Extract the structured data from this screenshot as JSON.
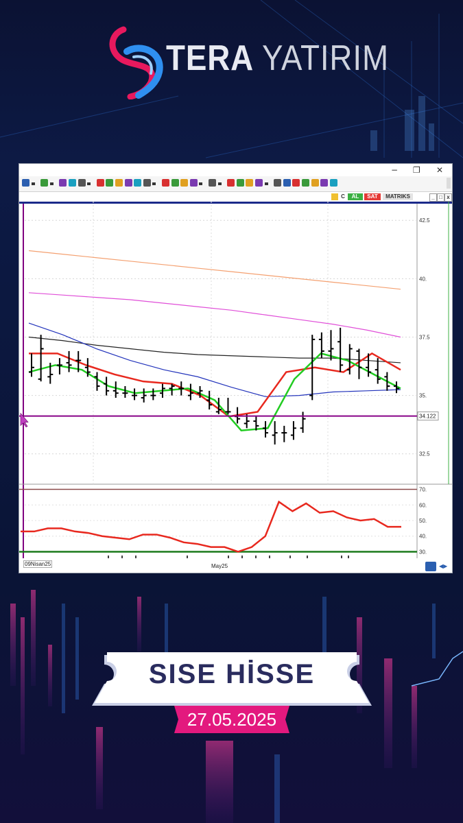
{
  "brand": {
    "name_part1": "TERA",
    "name_part2": "YATIRIM"
  },
  "window": {
    "controls": {
      "minimize": "−",
      "maximize": "❐",
      "close": "✕"
    },
    "toolbar_icons": [
      "u-icon",
      "arrow-icon",
      "globe-icon",
      "arrow-icon",
      "news-icon",
      "mail-icon",
      "m-icon",
      "arrow-icon",
      "chart-icon",
      "fx-icon",
      "user-icon",
      "chart-icon",
      "grid-icon",
      "phone-icon",
      "arrow-icon",
      "table-icon",
      "share-icon",
      "chart-icon",
      "search-icon",
      "arrow-icon",
      "book-icon",
      "arrow-icon",
      "v-icon",
      "grid-icon",
      "chart-icon",
      "edit-icon",
      "arrow-icon",
      "edit-icon",
      "triangle-icon",
      "bell-icon",
      "mail-icon",
      "calc-icon",
      "chat-icon",
      "settings-icon"
    ],
    "subbar": {
      "c_label": "C",
      "buy_label": "AL",
      "sell_label": "SAT",
      "brand_label": "MATRIKS",
      "btn_min": "_",
      "btn_max": "□",
      "btn_close": "x"
    },
    "colors": {
      "buy": "#3cb043",
      "sell": "#e53935"
    }
  },
  "chart_data": [
    {
      "type": "bar",
      "subtype": "ohlc",
      "ylim": [
        31.2,
        43.3
      ],
      "yticks": [
        {
          "v": 42.5,
          "label": "42.5"
        },
        {
          "v": 40.0,
          "label": "40."
        },
        {
          "v": 37.5,
          "label": "37.5"
        },
        {
          "v": 35.0,
          "label": "35."
        },
        {
          "v": 32.5,
          "label": "32.5"
        }
      ],
      "price_marker": "34.122",
      "x_labels": [
        "09Nisan25",
        "May25"
      ],
      "bars": [
        {
          "o": 36.0,
          "h": 36.8,
          "l": 35.8,
          "c": 36.2
        },
        {
          "o": 35.7,
          "h": 37.6,
          "l": 35.6,
          "c": 37.0
        },
        {
          "o": 35.8,
          "h": 36.4,
          "l": 35.5,
          "c": 35.9
        },
        {
          "o": 36.3,
          "h": 36.6,
          "l": 35.9,
          "c": 36.3
        },
        {
          "o": 36.4,
          "h": 36.9,
          "l": 36.0,
          "c": 36.3
        },
        {
          "o": 36.5,
          "h": 36.9,
          "l": 36.0,
          "c": 36.5
        },
        {
          "o": 36.2,
          "h": 36.6,
          "l": 35.8,
          "c": 36.0
        },
        {
          "o": 35.8,
          "h": 36.0,
          "l": 35.2,
          "c": 35.4
        },
        {
          "o": 35.5,
          "h": 35.8,
          "l": 35.0,
          "c": 35.2
        },
        {
          "o": 35.2,
          "h": 35.6,
          "l": 34.9,
          "c": 35.1
        },
        {
          "o": 35.1,
          "h": 35.4,
          "l": 34.9,
          "c": 35.1
        },
        {
          "o": 35.0,
          "h": 35.3,
          "l": 34.8,
          "c": 35.0
        },
        {
          "o": 34.9,
          "h": 35.3,
          "l": 34.7,
          "c": 35.0
        },
        {
          "o": 35.0,
          "h": 35.3,
          "l": 34.8,
          "c": 35.0
        },
        {
          "o": 35.1,
          "h": 35.5,
          "l": 34.9,
          "c": 35.3
        },
        {
          "o": 35.3,
          "h": 35.5,
          "l": 35.0,
          "c": 35.4
        },
        {
          "o": 35.3,
          "h": 35.6,
          "l": 35.0,
          "c": 35.3
        },
        {
          "o": 35.0,
          "h": 35.5,
          "l": 34.8,
          "c": 35.1
        },
        {
          "o": 35.1,
          "h": 35.4,
          "l": 34.9,
          "c": 35.2
        },
        {
          "o": 34.8,
          "h": 35.2,
          "l": 34.4,
          "c": 34.6
        },
        {
          "o": 34.3,
          "h": 34.9,
          "l": 34.2,
          "c": 34.4
        },
        {
          "o": 34.3,
          "h": 34.9,
          "l": 34.2,
          "c": 34.3
        },
        {
          "o": 34.1,
          "h": 34.5,
          "l": 33.8,
          "c": 34.0
        },
        {
          "o": 33.8,
          "h": 34.2,
          "l": 33.6,
          "c": 33.9
        },
        {
          "o": 33.9,
          "h": 34.1,
          "l": 33.5,
          "c": 33.7
        },
        {
          "o": 33.6,
          "h": 33.9,
          "l": 33.2,
          "c": 33.4
        },
        {
          "o": 33.3,
          "h": 33.9,
          "l": 32.9,
          "c": 33.4
        },
        {
          "o": 33.4,
          "h": 33.7,
          "l": 33.0,
          "c": 33.4
        },
        {
          "o": 33.3,
          "h": 33.9,
          "l": 33.1,
          "c": 33.6
        },
        {
          "o": 33.6,
          "h": 34.3,
          "l": 33.4,
          "c": 34.0
        },
        {
          "o": 35.0,
          "h": 37.6,
          "l": 34.8,
          "c": 37.4
        },
        {
          "o": 37.4,
          "h": 37.7,
          "l": 36.6,
          "c": 36.9
        },
        {
          "o": 36.9,
          "h": 37.8,
          "l": 36.5,
          "c": 37.0
        },
        {
          "o": 37.3,
          "h": 37.9,
          "l": 36.0,
          "c": 36.3
        },
        {
          "o": 36.1,
          "h": 37.2,
          "l": 35.9,
          "c": 37.0
        },
        {
          "o": 36.9,
          "h": 37.0,
          "l": 35.7,
          "c": 36.2
        },
        {
          "o": 36.2,
          "h": 36.8,
          "l": 35.8,
          "c": 36.0
        },
        {
          "o": 36.1,
          "h": 36.6,
          "l": 35.5,
          "c": 35.7
        },
        {
          "o": 35.8,
          "h": 36.0,
          "l": 35.2,
          "c": 35.4
        },
        {
          "o": 35.4,
          "h": 35.6,
          "l": 35.1,
          "c": 35.3
        }
      ],
      "lines": [
        {
          "color": "#f4a070",
          "values": [
            41.2,
            41.05,
            40.9,
            40.75,
            40.6,
            40.45,
            40.3,
            40.15,
            40.0,
            39.85,
            39.7,
            39.55
          ]
        },
        {
          "color": "#e04ed8",
          "values": [
            39.4,
            39.3,
            39.2,
            39.1,
            38.95,
            38.8,
            38.65,
            38.45,
            38.25,
            38.05,
            37.8,
            37.5
          ]
        },
        {
          "color": "#222222",
          "values": [
            37.5,
            37.35,
            37.15,
            37.0,
            36.85,
            36.75,
            36.7,
            36.65,
            36.6,
            36.6,
            36.5,
            36.4
          ]
        },
        {
          "color": "#2233bb",
          "values": [
            38.1,
            37.6,
            37.0,
            36.5,
            36.1,
            35.8,
            35.35,
            34.95,
            35.0,
            35.15,
            35.2,
            35.25
          ]
        },
        {
          "color": "#e8281e",
          "values": [
            36.8,
            36.8,
            36.3,
            35.9,
            35.6,
            35.5,
            35.0,
            34.1,
            34.3,
            36.0,
            36.2,
            36.0,
            36.8,
            36.1
          ]
        },
        {
          "color": "#22cc22",
          "values": [
            36.0,
            36.3,
            36.1,
            35.4,
            35.1,
            35.2,
            35.3,
            34.8,
            33.5,
            33.6,
            35.7,
            36.8,
            36.5,
            35.9,
            35.3
          ]
        }
      ],
      "hline": {
        "v": 34.12,
        "color": "#880088"
      }
    },
    {
      "type": "line",
      "ylim": [
        28,
        72
      ],
      "yticks": [
        {
          "v": 70,
          "label": "70."
        },
        {
          "v": 60,
          "label": "60."
        },
        {
          "v": 50,
          "label": "50."
        },
        {
          "v": 40,
          "label": "40."
        },
        {
          "v": 30,
          "label": "30."
        }
      ],
      "values": [
        43,
        43,
        45,
        45,
        43,
        42,
        40,
        39,
        38,
        41,
        41,
        39,
        36,
        35,
        33,
        33,
        30,
        33,
        40,
        62,
        56,
        61,
        55,
        56,
        52,
        50,
        51,
        46,
        46
      ],
      "hline": {
        "v": 30,
        "color": "#1a7a1a"
      }
    }
  ],
  "banner": {
    "title": "SISE HİSSE",
    "date": "27.05.2025"
  }
}
